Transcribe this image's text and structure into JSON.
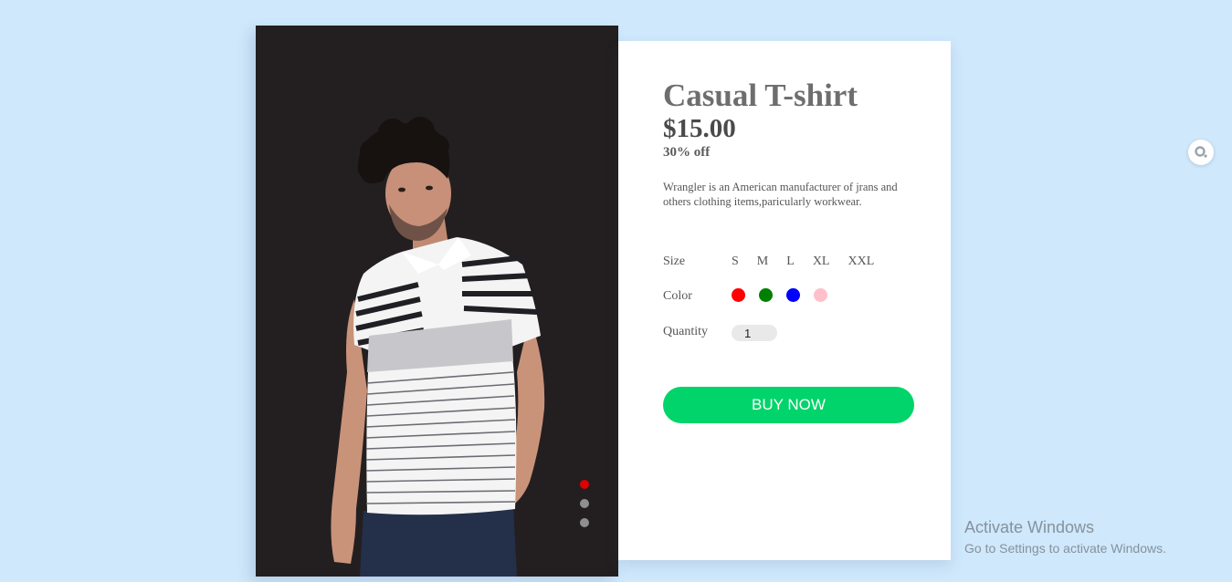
{
  "product": {
    "title": "Casual T-shirt",
    "price": "$15.00",
    "discount": "30% off",
    "description": "Wrangler is an American manufacturer of jrans and others clothing items,paricularly workwear."
  },
  "options": {
    "size_label": "Size",
    "sizes": [
      "S",
      "M",
      "L",
      "XL",
      "XXL"
    ],
    "color_label": "Color",
    "colors": [
      "#ff0000",
      "#008000",
      "#0000ff",
      "#ffc0cb"
    ],
    "quantity_label": "Quantity",
    "quantity_value": "1"
  },
  "actions": {
    "buy_label": "BUY NOW"
  },
  "carousel": {
    "dot_colors": [
      "#e00000",
      "#8f8f8f",
      "#8f8f8f"
    ]
  },
  "watermark": {
    "title": "Activate Windows",
    "subtitle": "Go to Settings to activate Windows."
  }
}
